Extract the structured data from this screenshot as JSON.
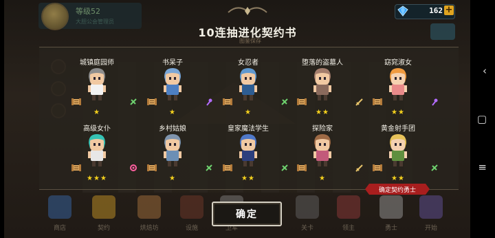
{
  "title": "10连抽进化契约书",
  "title_sub": "图鉴保存",
  "player": {
    "level": "等级52",
    "subtitle": "大胆公会管理员"
  },
  "currency": {
    "gems": "162",
    "plus": "+"
  },
  "characters": [
    {
      "name": "城镇庭园师",
      "stars": "★",
      "class": "assassin-icon",
      "hair": "#8d8d8d",
      "skin": "#f1c9a2",
      "body": "#f2f2f2"
    },
    {
      "name": "书呆子",
      "stars": "★",
      "class": "mage-icon",
      "hair": "#7aa6d6",
      "skin": "#f1c9a2",
      "body": "#4d7fc2"
    },
    {
      "name": "女忍者",
      "stars": "★",
      "class": "assassin-icon",
      "hair": "#5f98cf",
      "skin": "#f1c9a2",
      "body": "#2e5d92"
    },
    {
      "name": "堕落的盗墓人",
      "stars": "★★",
      "class": "warrior-icon",
      "hair": "#a47e6d",
      "skin": "#f1c9a2",
      "body": "#8a6a5c"
    },
    {
      "name": "窈窕淑女",
      "stars": "★★",
      "class": "mage-icon",
      "hair": "#f09a3f",
      "skin": "#f5d1b0",
      "body": "#e98a8a"
    },
    {
      "name": "高级女仆",
      "stars": "★★★",
      "class": "support-icon",
      "hair": "#36c2b4",
      "skin": "#f1c9a2",
      "body": "#e7e7e7"
    },
    {
      "name": "乡村姑娘",
      "stars": "★",
      "class": "assassin-icon",
      "hair": "#7f94ad",
      "skin": "#f1c9a2",
      "body": "#6c8fb5"
    },
    {
      "name": "皇家魔法学生",
      "stars": "★★",
      "class": "assassin-icon",
      "hair": "#4f78c8",
      "skin": "#f1c9a2",
      "body": "#2d3f7d"
    },
    {
      "name": "探险家",
      "stars": "★",
      "class": "warrior-icon",
      "hair": "#9e6a45",
      "skin": "#f1c9a2",
      "body": "#c25a7a"
    },
    {
      "name": "黄金射手团",
      "stars": "★★",
      "class": "assassin-icon",
      "hair": "#e7c25a",
      "skin": "#f5d1b0",
      "body": "#5f8f3f"
    }
  ],
  "badge": "确定契约勇士",
  "confirm_label": "确定",
  "dock": [
    {
      "label": "商店",
      "color": "#3a6fb5"
    },
    {
      "label": "契约",
      "color": "#d8a228"
    },
    {
      "label": "烘焙坊",
      "color": "#b37a40"
    },
    {
      "label": "设施",
      "color": "#7a3b2c"
    },
    {
      "label": "卫军",
      "color": "#8a8a8a"
    },
    {
      "label": "关卡",
      "color": "#6b6b6b"
    },
    {
      "label": "领主",
      "color": "#9b3b3b"
    },
    {
      "label": "勇士",
      "color": "#a6a6a6"
    },
    {
      "label": "开始",
      "color": "#6a58a8"
    }
  ],
  "colors": {
    "star": "#f5d11d",
    "badge": "#a81e1e",
    "panel": "#28241e"
  }
}
